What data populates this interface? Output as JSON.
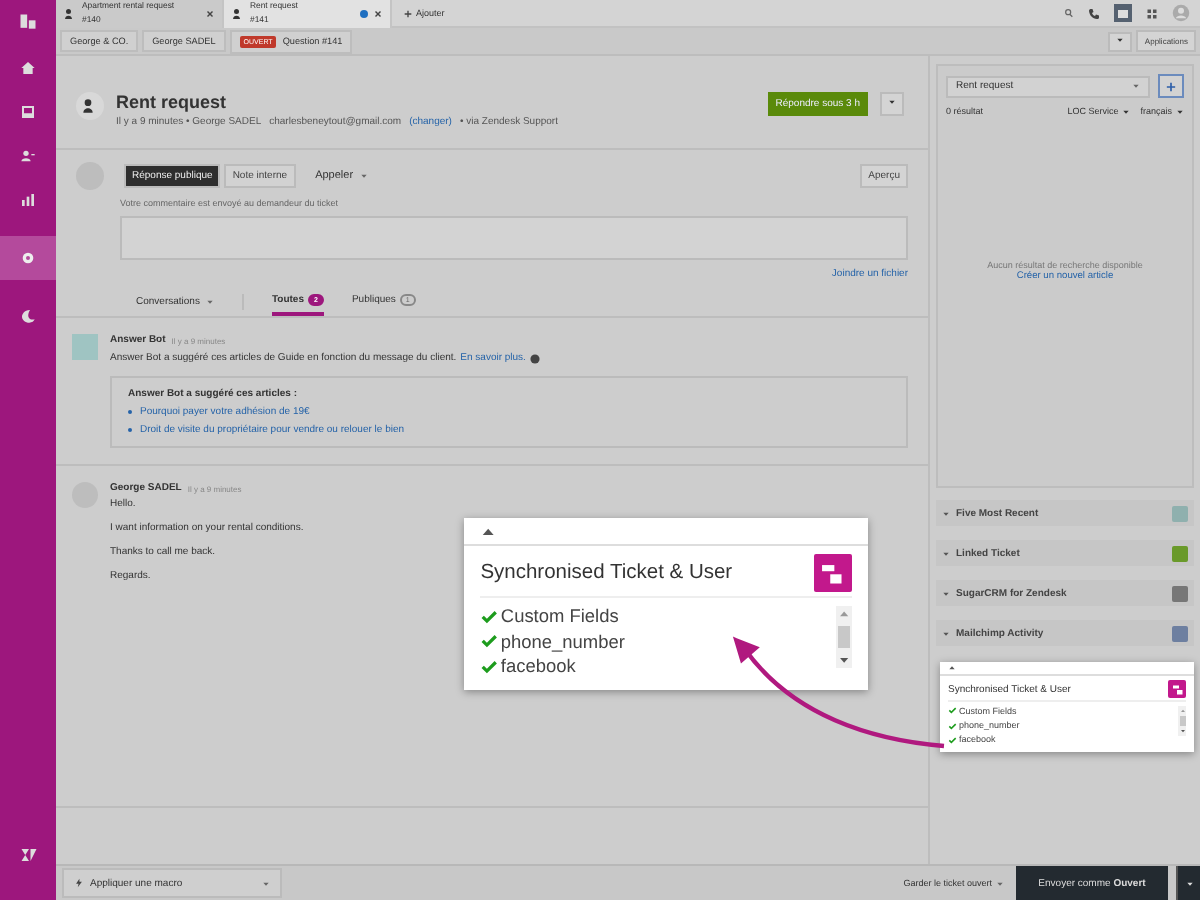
{
  "tabs": [
    {
      "title": "Apartment rental request",
      "number": "#140",
      "selected": false,
      "unread": false
    },
    {
      "title": "Rent request",
      "number": "#141",
      "selected": true,
      "unread": true
    }
  ],
  "add_tab": "Ajouter",
  "breadcrumbs": [
    {
      "label": "George & CO."
    },
    {
      "label": "George SADEL"
    },
    {
      "label": "Question #141",
      "badge": "OUVERT"
    }
  ],
  "apps_button": "Applications",
  "ticket": {
    "title": "Rent request",
    "meta": "Il y a 9 minutes • George SADEL",
    "email": "charlesbeneytout@gmail.com",
    "change_link": "(changer)",
    "via": "• via Zendesk Support",
    "respond_button": "Répondre sous 3 h"
  },
  "composer": {
    "modes": [
      {
        "label": "Réponse publique",
        "selected": true
      },
      {
        "label": "Note interne",
        "selected": false
      }
    ],
    "call": "Appeler",
    "preview": "Aperçu",
    "hint": "Votre commentaire est envoyé au demandeur du ticket",
    "attach": "Joindre un fichier"
  },
  "filters": {
    "conversations": "Conversations",
    "tabs": [
      {
        "label": "Toutes",
        "count": "2",
        "selected": true
      },
      {
        "label": "Publiques",
        "count": "1",
        "selected": false
      }
    ]
  },
  "answer_bot": {
    "author": "Answer Bot",
    "time": "Il y a 9 minutes",
    "text": "Answer Bot a suggéré ces articles de Guide en fonction du message du client.",
    "link": "En savoir plus.",
    "box_title": "Answer Bot a suggéré ces articles :",
    "articles": [
      "Pourquoi payer votre adhésion de 19€",
      "Droit de visite du propriétaire pour vendre ou relouer le bien"
    ]
  },
  "message": {
    "author": "George SADEL",
    "time": "Il y a 9 minutes",
    "paragraphs": [
      "Hello.",
      "I want information on your rental conditions.",
      "Thanks to call me back.",
      "Regards."
    ]
  },
  "knowledge": {
    "search": "Rent request",
    "count": "0 résultat",
    "brand": "LOC Service",
    "language": "français",
    "empty": "Aucun résultat de recherche disponible",
    "create_link": "Créer un nouvel article"
  },
  "apps": [
    {
      "name": "Five Most Recent",
      "expanded": false
    },
    {
      "name": "Linked Ticket",
      "expanded": false
    },
    {
      "name": "SugarCRM for Zendesk",
      "expanded": false
    },
    {
      "name": "Mailchimp Activity",
      "expanded": false
    }
  ],
  "widget": {
    "title": "Synchronised Ticket & User",
    "items": [
      "Custom Fields",
      "phone_number",
      "facebook"
    ]
  },
  "callout": {
    "title": "Synchronised Ticket & User",
    "items": [
      "Custom Fields",
      "phone_number",
      "facebook"
    ]
  },
  "footer": {
    "macro": "Appliquer une macro",
    "keep_open": "Garder le ticket ouvert",
    "submit": "Envoyer comme **Ouvert**"
  }
}
